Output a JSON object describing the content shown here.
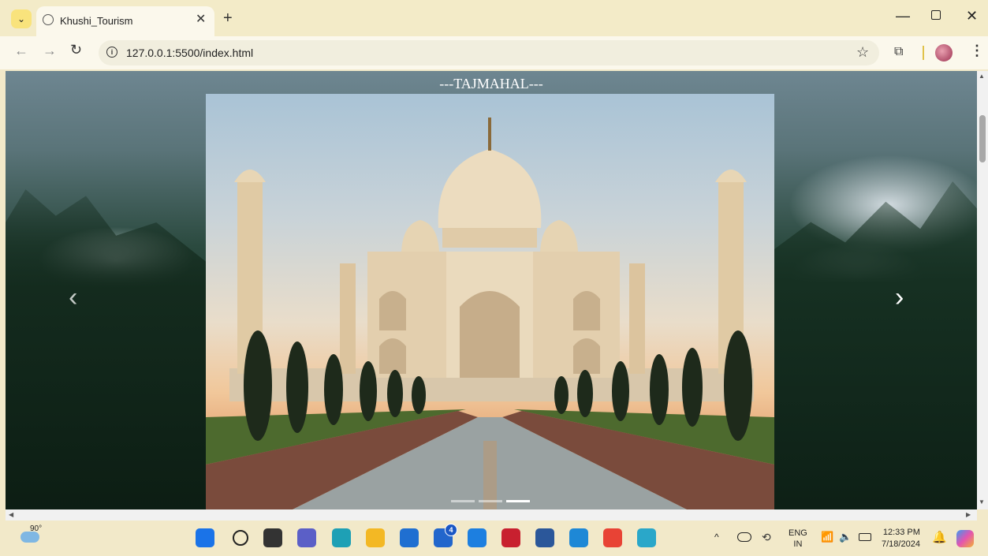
{
  "browser": {
    "tab_title": "Khushi_Tourism",
    "url": "127.0.0.1:5500/index.html"
  },
  "page": {
    "slide_heading": "---TAJMAHAL---",
    "carousel": {
      "indicator_count": 3,
      "active_index": 2
    }
  },
  "taskbar": {
    "weather_temp": "90°",
    "apps": [
      {
        "name": "start-icon",
        "color": "#1a73e8"
      },
      {
        "name": "search-icon",
        "color": "#222222"
      },
      {
        "name": "task-view-icon",
        "color": "#333333"
      },
      {
        "name": "teams-icon",
        "color": "#5b5fc7"
      },
      {
        "name": "edge-icon",
        "color": "#1ea0b5"
      },
      {
        "name": "file-explorer-icon",
        "color": "#f3b824"
      },
      {
        "name": "store-icon",
        "color": "#1f6fd1"
      },
      {
        "name": "launcher-icon",
        "color": "#2266cc"
      },
      {
        "name": "circle-app-icon",
        "color": "#1d7fe0"
      },
      {
        "name": "mcafee-icon",
        "color": "#c8202f"
      },
      {
        "name": "word-icon",
        "color": "#2b579a"
      },
      {
        "name": "vscode-icon",
        "color": "#1e88d6"
      },
      {
        "name": "chrome-icon",
        "color": "#e84335"
      },
      {
        "name": "snipping-tool-icon",
        "color": "#2aa7c9"
      }
    ],
    "launcher_badge": "4",
    "language": "ENG",
    "region": "IN",
    "time": "12:33 PM",
    "date": "7/18/2024"
  }
}
